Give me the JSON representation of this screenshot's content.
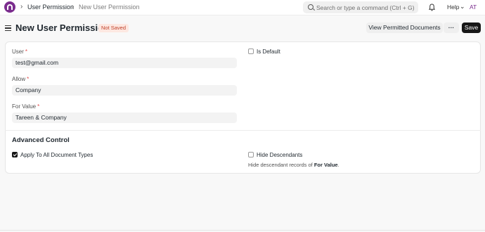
{
  "navbar": {
    "breadcrumbs": [
      "User Permission",
      "New User Permission"
    ],
    "separator": "›",
    "search_placeholder": "Search or type a command (Ctrl + G)",
    "help_label": "Help",
    "help_chevron": "⌄",
    "avatar_initials": "AT"
  },
  "header": {
    "title": "New User Permission",
    "status": "Not Saved",
    "buttons": {
      "view_permitted": "View Permitted Documents",
      "more": "···",
      "save": "Save"
    }
  },
  "form": {
    "user": {
      "label": "User",
      "required": "*",
      "value": "test@gmail.com"
    },
    "allow": {
      "label": "Allow",
      "required": "*",
      "value": "Company"
    },
    "for_value": {
      "label": "For Value",
      "required": "*",
      "value": "Tareen & Company"
    },
    "is_default": {
      "label": "Is Default",
      "checked": false
    }
  },
  "advanced": {
    "title": "Advanced Control",
    "apply_all": {
      "label": "Apply To All Document Types",
      "checked": true
    },
    "hide_descendants": {
      "label": "Hide Descendants",
      "checked": false
    },
    "description_prefix": "Hide descendant records of ",
    "description_bold": "For Value",
    "description_suffix": "."
  },
  "colors": {
    "brand": "#7b2d8e",
    "status_text": "#c0412a",
    "status_bg": "#fde8e1",
    "save_bg": "#171717"
  },
  "icons": {
    "logo": "frappe-logo",
    "menu": "hamburger-icon",
    "search": "search-icon",
    "notifications": "bell-icon"
  }
}
